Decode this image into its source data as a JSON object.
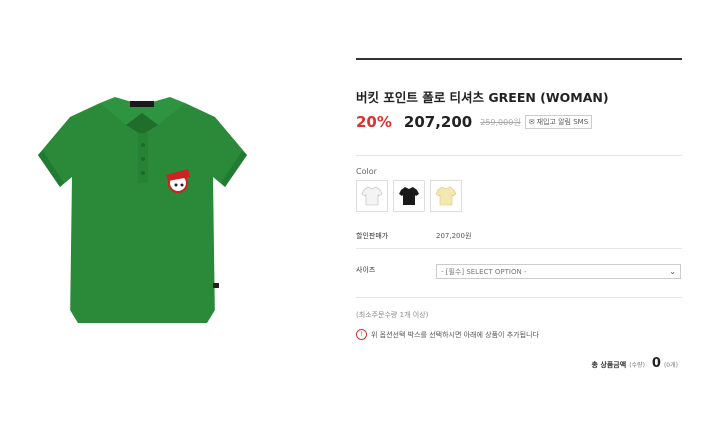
{
  "product": {
    "title": "버킷 포인트 폴로 티셔츠 GREEN (WOMAN)",
    "discount": "20%",
    "price": "207,200",
    "original_price": "259,000원",
    "restock_label": "재입고 알림 SMS"
  },
  "options": {
    "color_label": "Color",
    "colors": [
      {
        "name": "white",
        "hex": "#f4f4f4"
      },
      {
        "name": "black",
        "hex": "#1a1a1a"
      },
      {
        "name": "yellow",
        "hex": "#f5e7b0"
      }
    ],
    "sale_price_label": "할인판매가",
    "sale_price_value": "207,200원",
    "size_label": "사이즈",
    "size_select": "- [필수] SELECT OPTION -"
  },
  "notes": {
    "min_qty": "(최소주문수량 1개 이상)",
    "info": "위 옵션선택 박스를 선택하시면 아래에 상품이 추가됩니다"
  },
  "total": {
    "label": "총 상품금액",
    "sub": "(수량)",
    "amount": "0",
    "unit": "(0개)"
  },
  "colors": {
    "accent": "#e03131",
    "shirt": "#2a8a3a"
  }
}
